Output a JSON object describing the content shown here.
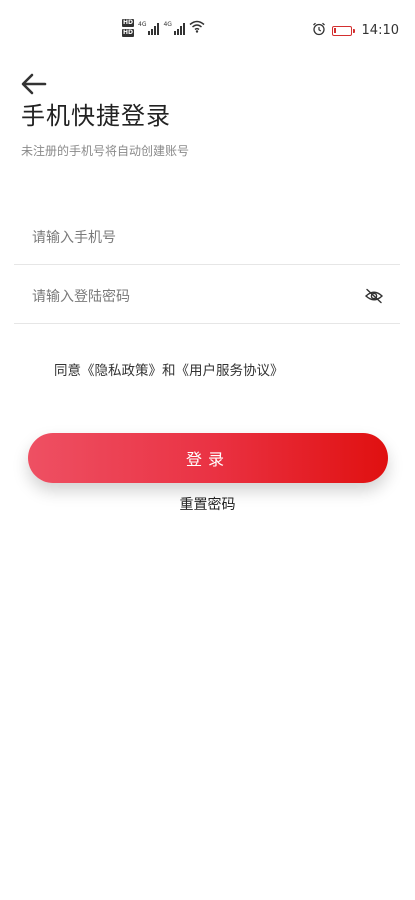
{
  "status_bar": {
    "badge_top": "HD",
    "badge_bottom": "HD",
    "network_a": "4G",
    "network_b": "4G",
    "time": "14:10",
    "battery_level": 0.15,
    "battery_color": "#d32f2f",
    "icons": [
      "signal-icon",
      "wifi-icon",
      "alarm-icon",
      "battery-icon"
    ]
  },
  "header": {
    "back_icon": "arrow-left-icon",
    "title": "手机快捷登录",
    "subtitle": "未注册的手机号将自动创建账号"
  },
  "form": {
    "phone": {
      "value": "",
      "placeholder": "请输入手机号"
    },
    "password": {
      "value": "",
      "placeholder": "请输入登陆密码",
      "toggle_icon": "eye-off-icon"
    }
  },
  "agreement": {
    "prefix": "同意",
    "privacy_link": "《隐私政策》",
    "conjunction": "和",
    "service_link": "《用户服务协议》"
  },
  "actions": {
    "login_label": "登录",
    "reset_label": "重置密码"
  },
  "colors": {
    "accent_start": "#ee5063",
    "accent_end": "#e01010",
    "text_primary": "#222222",
    "text_secondary": "#8a8a8a",
    "divider": "#e6e6e6"
  }
}
